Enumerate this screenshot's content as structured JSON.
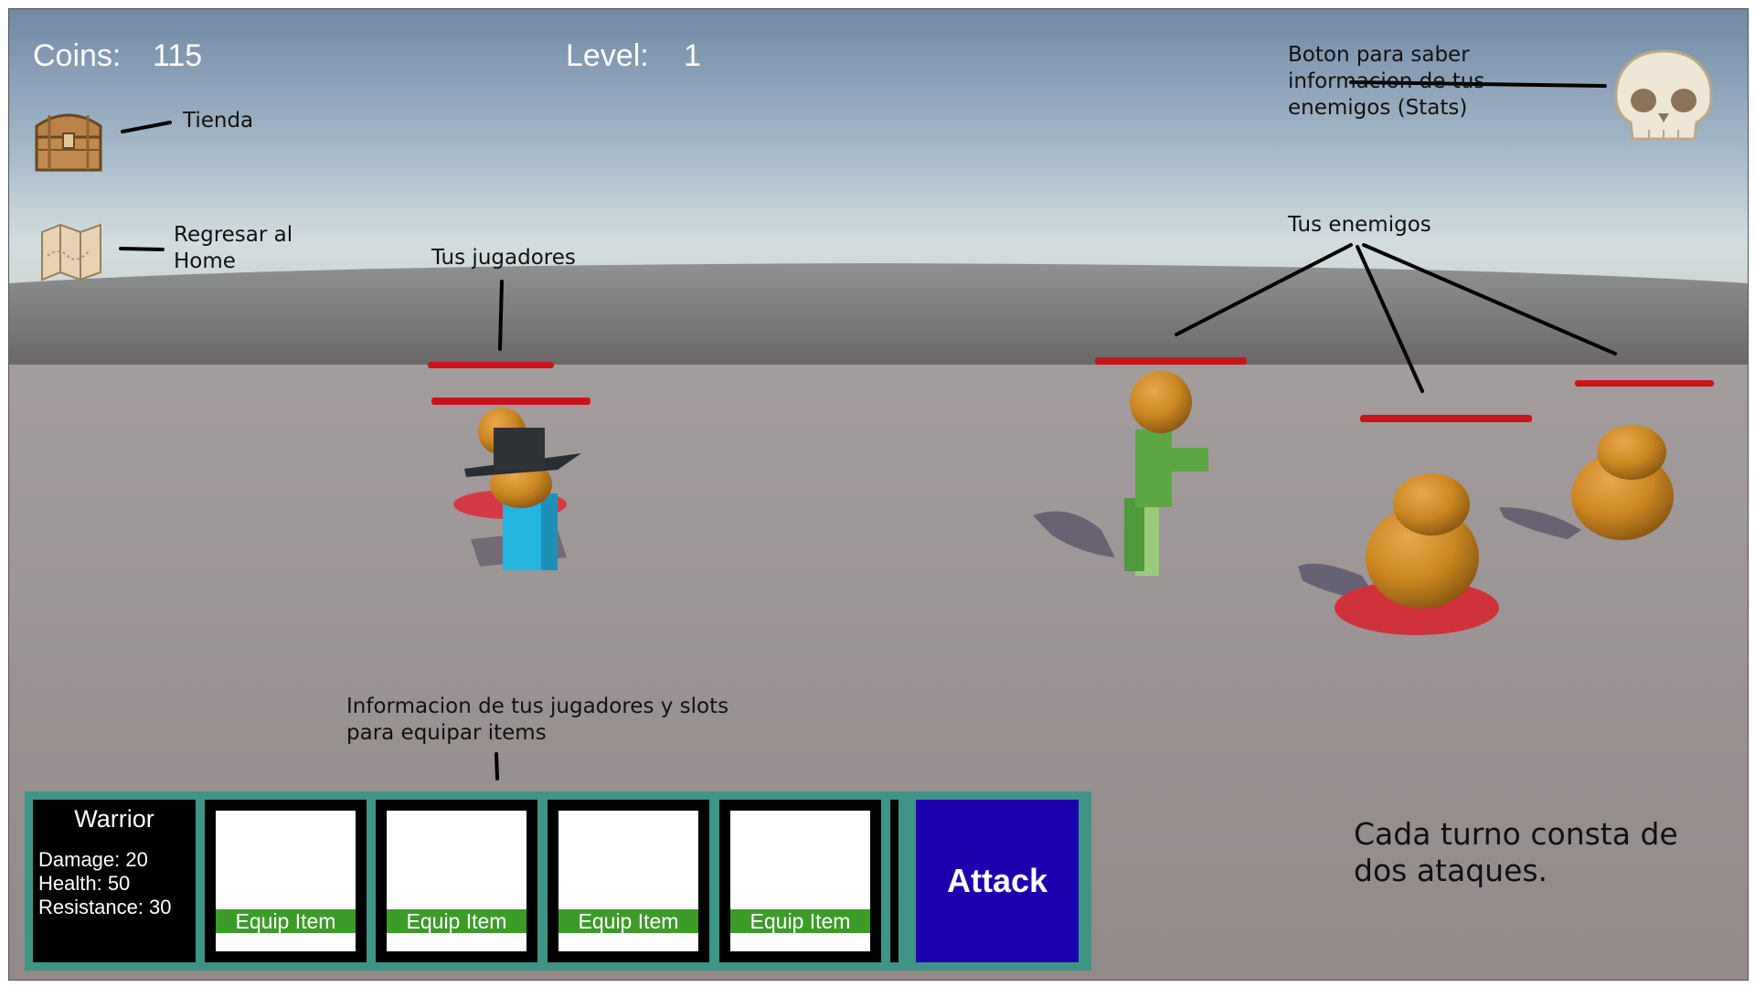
{
  "hud": {
    "coins_label": "Coins:",
    "coins_value": "115",
    "level_label": "Level:",
    "level_value": "1"
  },
  "annotations": {
    "shop": "Tienda",
    "home": "Regresar al\nHome",
    "players": "Tus jugadores",
    "enemies": "Tus enemigos",
    "stats": "Boton para saber\ninformacion de tus\nenemigos (Stats)",
    "slots": "Informacion de tus jugadores y slots\npara equipar items",
    "turn": "Cada turno consta de\ndos ataques."
  },
  "player_card": {
    "class_name": "Warrior",
    "damage": "Damage: 20",
    "health": "Health: 50",
    "resistance": "Resistance: 30"
  },
  "slots": [
    {
      "label": "Equip Item"
    },
    {
      "label": "Equip Item"
    },
    {
      "label": "Equip Item"
    },
    {
      "label": "Equip Item"
    }
  ],
  "attack_label": "Attack",
  "icons": {
    "shop": "treasure-chest-icon",
    "home": "map-icon",
    "stats": "skull-icon"
  },
  "colors": {
    "health_bar": "#c8141a",
    "panel_border": "#3e9586",
    "attack_button": "#1d00ad",
    "equip_button": "#3d9b2a"
  }
}
